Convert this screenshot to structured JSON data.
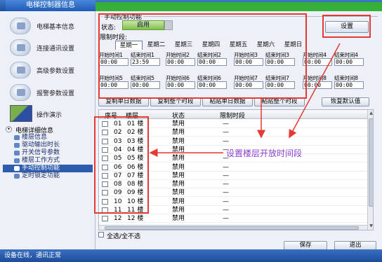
{
  "window": {
    "title": "电梯控制器信息"
  },
  "sidebar": {
    "items": [
      {
        "label": "电梯基本信息",
        "icon": "device-info-icon"
      },
      {
        "label": "连接通讯设置",
        "icon": "connection-icon"
      },
      {
        "label": "高级参数设置",
        "icon": "advanced-settings-icon"
      },
      {
        "label": "报警参数设置",
        "icon": "alarm-icon"
      },
      {
        "label": "操作演示",
        "icon": "demo-icon"
      }
    ],
    "tree": {
      "root_label": "电梯详细信息",
      "toggle_glyph": "▾",
      "items": [
        {
          "label": "楼层信息",
          "active": false
        },
        {
          "label": "驱动输出时长",
          "active": false
        },
        {
          "label": "开关信号参数",
          "active": false
        },
        {
          "label": "楼层工作方式",
          "active": false
        },
        {
          "label": "手动控制功能",
          "active": true
        },
        {
          "label": "定时锁定功能",
          "active": false
        }
      ]
    }
  },
  "manual_control": {
    "group_title": "手动控制功能",
    "state_label": "状态:",
    "state_value": "启用",
    "limit_label": "限制时段:",
    "days": [
      "星期一",
      "星期二",
      "星期三",
      "星期四",
      "星期五",
      "星期六",
      "星期日"
    ],
    "active_day": "星期一",
    "periods": [
      {
        "label": "开始时间1",
        "value": "00:00"
      },
      {
        "label": "结束时间1",
        "value": "23:59"
      },
      {
        "label": "开始时间2",
        "value": "00:00"
      },
      {
        "label": "结束时间2",
        "value": "00:00"
      },
      {
        "label": "开始时间3",
        "value": "00:00"
      },
      {
        "label": "结束时间3",
        "value": "00:00"
      },
      {
        "label": "开始时间4",
        "value": "00:00"
      },
      {
        "label": "结束时间4",
        "value": "00:00"
      },
      {
        "label": "开始时间5",
        "value": "00:00"
      },
      {
        "label": "结束时间5",
        "value": "00:00"
      },
      {
        "label": "开始时间6",
        "value": "00:00"
      },
      {
        "label": "结束时间6",
        "value": "00:00"
      },
      {
        "label": "开始时间7",
        "value": "00:00"
      },
      {
        "label": "结束时间7",
        "value": "00:00"
      },
      {
        "label": "开始时间8",
        "value": "00:00"
      },
      {
        "label": "结束时间8",
        "value": "00:00"
      }
    ],
    "set_button": "设置",
    "buttons": [
      "复制单日数据",
      "复制整个时段",
      "粘贴单日数据",
      "粘贴整个时段"
    ],
    "restore_button": "恢复默认值"
  },
  "table": {
    "headers": [
      "序号",
      "楼层",
      "状态",
      "限制时段"
    ],
    "rows": [
      {
        "no": "01",
        "floor": "01 楼",
        "state": "禁用",
        "limit": "—"
      },
      {
        "no": "02",
        "floor": "02 楼",
        "state": "禁用",
        "limit": "—"
      },
      {
        "no": "03",
        "floor": "03 楼",
        "state": "禁用",
        "limit": "—"
      },
      {
        "no": "04",
        "floor": "04 楼",
        "state": "禁用",
        "limit": "—"
      },
      {
        "no": "05",
        "floor": "05 楼",
        "state": "禁用",
        "limit": "—"
      },
      {
        "no": "06",
        "floor": "06 楼",
        "state": "禁用",
        "limit": "—"
      },
      {
        "no": "07",
        "floor": "07 楼",
        "state": "禁用",
        "limit": "—"
      },
      {
        "no": "08",
        "floor": "08 楼",
        "state": "禁用",
        "limit": "—"
      },
      {
        "no": "09",
        "floor": "09 楼",
        "state": "禁用",
        "limit": "—"
      },
      {
        "no": "10",
        "floor": "10 楼",
        "state": "禁用",
        "limit": "—"
      },
      {
        "no": "11",
        "floor": "11 楼",
        "state": "禁用",
        "limit": "—"
      },
      {
        "no": "12",
        "floor": "12 楼",
        "state": "禁用",
        "limit": "—"
      }
    ],
    "select_all_label": "全选/全不选"
  },
  "footer": {
    "save_button": "保存",
    "exit_button": "退出"
  },
  "status_bar": {
    "text": "设备在线，通讯正常"
  },
  "annotation": {
    "text": "设置楼层开放时间段",
    "text_color": "#8b3fd0",
    "highlight_color": "#e53935"
  },
  "colors": {
    "title_bar": "#2a5fb3",
    "selected_tree_item": "#2e5cae",
    "state_enabled": "#7ec04a",
    "accent_green": "#34b038"
  }
}
